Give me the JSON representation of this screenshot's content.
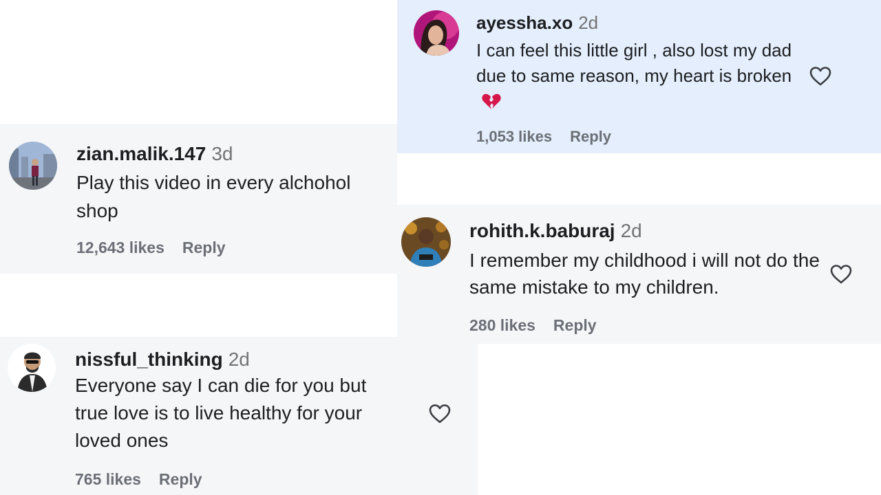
{
  "comments": [
    {
      "username": "ayessha.xo",
      "time": "2d",
      "text": "I can feel this little girl , also lost my dad due to same reason, my heart is broken",
      "emoji": "broken-heart-emoji",
      "likes": "1,053 likes",
      "reply": "Reply",
      "background": "#e4eefc"
    },
    {
      "username": "zian.malik.147",
      "time": "3d",
      "text": "Play this video in every alchohol shop",
      "likes": "12,643 likes",
      "reply": "Reply",
      "background": "#f5f6f8"
    },
    {
      "username": "rohith.k.baburaj",
      "time": "2d",
      "text": "I remember my childhood i will not do the same mistake to my children.",
      "likes": "280 likes",
      "reply": "Reply",
      "background": "#f5f6f8"
    },
    {
      "username": "nissful_thinking",
      "time": "2d",
      "text": "Everyone say I can die for you but true love is to live healthy for your loved ones",
      "likes": "765 likes",
      "reply": "Reply",
      "background": "#f5f6f8"
    }
  ],
  "icons": {
    "like": "heart-outline-icon"
  },
  "colors": {
    "broken_heart": "#d6174a",
    "meta_text": "#6b6f76",
    "timestamp": "#737373"
  }
}
